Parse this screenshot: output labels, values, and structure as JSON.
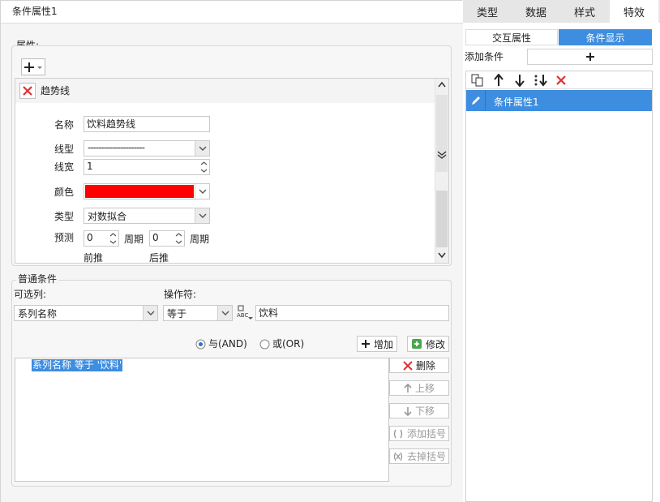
{
  "dialog": {
    "title": "条件属性1",
    "attributes_label": "属性:",
    "trend": {
      "item_label": "趋势线",
      "name_label": "名称",
      "name_value": "饮料趋势线",
      "linetype_label": "线型",
      "linetype_value": "---------------------",
      "linewidth_label": "线宽",
      "linewidth_value": "1",
      "color_label": "颜色",
      "color_value": "#ff0000",
      "type_label": "类型",
      "type_value": "对数拟合",
      "forecast_label": "预测",
      "forecast_forward_value": "0",
      "period_label": "周期",
      "forecast_backward_value": "0",
      "period_label2": "周期",
      "forward_label": "前推",
      "backward_label": "后推"
    },
    "common": {
      "title": "普通条件",
      "optional_column_label": "可选列:",
      "operator_label": "操作符:",
      "column_value": "系列名称",
      "operator_value": "等于",
      "value_input": "饮料",
      "and_label": "与(AND)",
      "or_label": "或(OR)",
      "add_label": "增加",
      "modify_label": "修改",
      "conditions": [
        "系列名称 等于 '饮料'"
      ],
      "delete_label": "删除",
      "move_up_label": "上移",
      "move_down_label": "下移",
      "add_bracket_label": "添加括号",
      "remove_bracket_label": "去掉括号"
    }
  },
  "right_panel": {
    "tabs": [
      "类型",
      "数据",
      "样式",
      "特效"
    ],
    "subtabs": [
      "交互属性",
      "条件显示"
    ],
    "add_condition_label": "添加条件",
    "conditions": [
      "条件属性1"
    ]
  }
}
